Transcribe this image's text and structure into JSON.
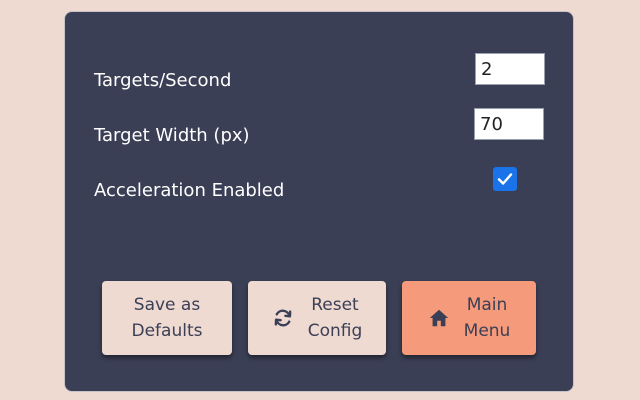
{
  "settings": {
    "targets_per_second": {
      "label": "Targets/Second",
      "value": "2"
    },
    "target_width": {
      "label": "Target Width (px)",
      "value": "70"
    },
    "acceleration": {
      "label": "Acceleration Enabled",
      "checked": true
    }
  },
  "buttons": {
    "save_defaults": {
      "label": "Save as\nDefaults"
    },
    "reset_config": {
      "label": "Reset\nConfig",
      "icon": "refresh-icon"
    },
    "main_menu": {
      "label": "Main\nMenu",
      "icon": "home-icon"
    }
  },
  "colors": {
    "page_background": "#efdad2",
    "panel_background": "#3b3f55",
    "checkbox_accent": "#1a73e8",
    "accent_button": "#f59a7a"
  }
}
